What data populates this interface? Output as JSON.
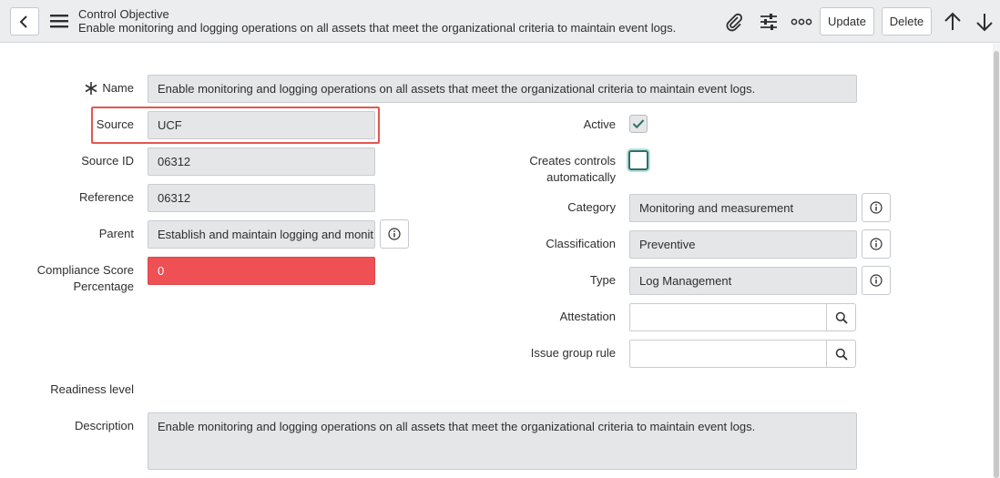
{
  "header": {
    "record_type": "Control Objective",
    "record_name": "Enable monitoring and logging operations on all assets that meet the organizational criteria to maintain event logs.",
    "update_label": "Update",
    "delete_label": "Delete"
  },
  "form": {
    "name": {
      "label": "Name",
      "value": "Enable monitoring and logging operations on all assets that meet the organizational criteria to maintain event logs."
    },
    "source": {
      "label": "Source",
      "value": "UCF"
    },
    "source_id": {
      "label": "Source ID",
      "value": "06312"
    },
    "reference": {
      "label": "Reference",
      "value": "06312"
    },
    "parent": {
      "label": "Parent",
      "value": "Establish and maintain logging and monit"
    },
    "compliance_score": {
      "label_line1": "Compliance Score",
      "label_line2": "Percentage",
      "value": "0"
    },
    "active": {
      "label": "Active",
      "checked": true
    },
    "creates_controls": {
      "label_line1": "Creates controls",
      "label_line2": "automatically",
      "checked": false
    },
    "category": {
      "label": "Category",
      "value": "Monitoring and measurement"
    },
    "classification": {
      "label": "Classification",
      "value": "Preventive"
    },
    "type": {
      "label": "Type",
      "value": "Log Management"
    },
    "attestation": {
      "label": "Attestation",
      "value": ""
    },
    "issue_group_rule": {
      "label": "Issue group rule",
      "value": ""
    },
    "readiness_level": {
      "label": "Readiness level"
    },
    "description": {
      "label": "Description",
      "value": "Enable monitoring and logging operations on all assets that meet the organizational criteria to maintain event logs."
    }
  },
  "colors": {
    "accent": "#2f6f6b",
    "highlight": "#e4574f",
    "score_red": "#ef5053"
  }
}
